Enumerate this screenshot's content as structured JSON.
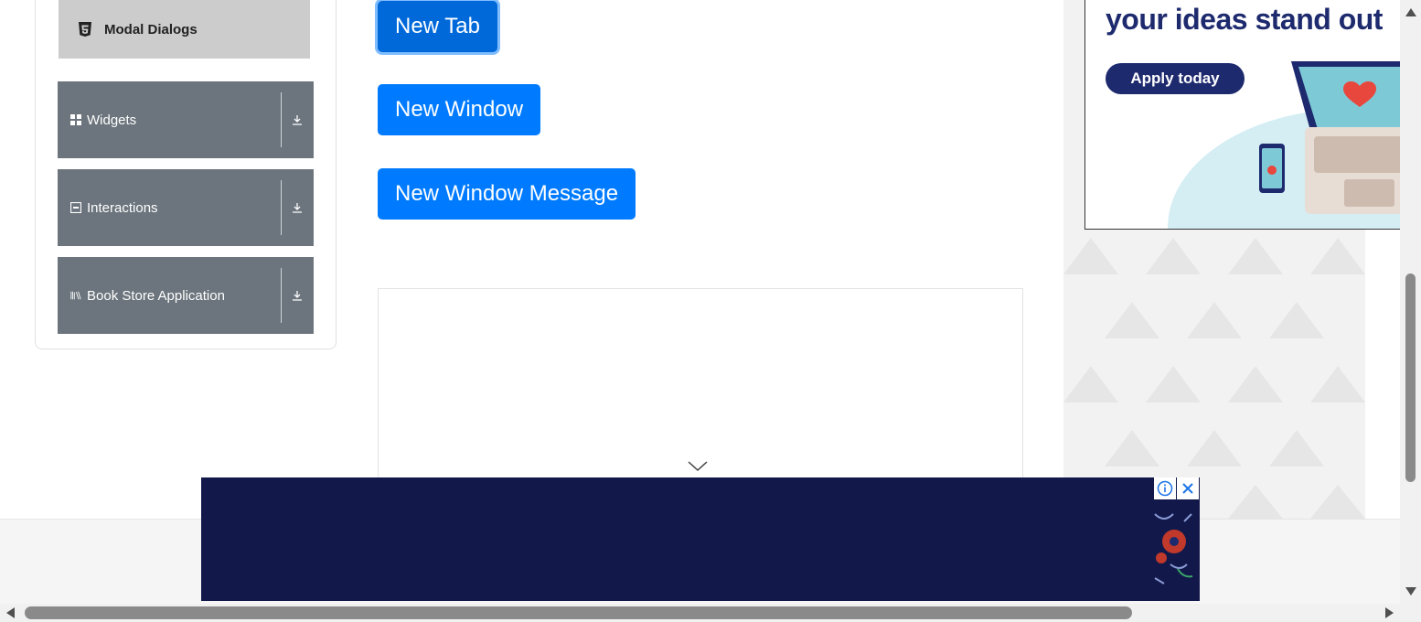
{
  "sidebar": {
    "active_item": {
      "label": "Modal Dialogs",
      "icon": "html5-icon"
    },
    "groups": [
      {
        "label": "Widgets",
        "icon": "widgets-grid-icon"
      },
      {
        "label": "Interactions",
        "icon": "interactions-icon"
      },
      {
        "label": "Book Store Application",
        "icon": "books-icon"
      }
    ]
  },
  "main": {
    "buttons": {
      "new_tab": "New Tab",
      "new_window": "New Window",
      "new_window_message": "New Window Message"
    }
  },
  "ad_right": {
    "headline": "your ideas stand out",
    "cta": "Apply today"
  },
  "colors": {
    "primary_button": "#007bff",
    "sidebar_group": "#6c757d",
    "sidebar_active": "#cccccc",
    "ad_navy": "#12184a"
  }
}
